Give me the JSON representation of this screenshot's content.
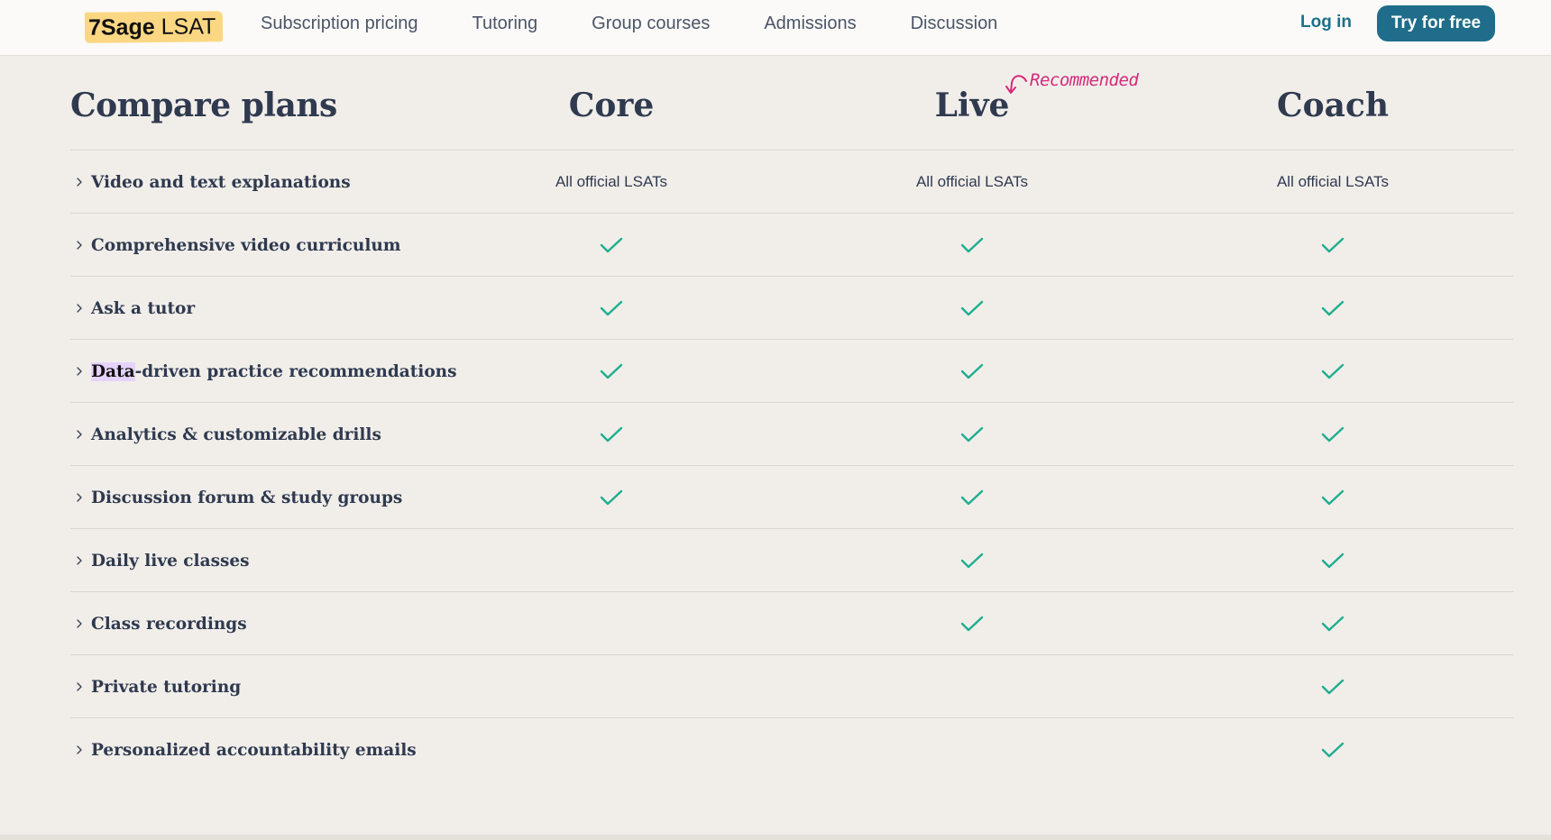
{
  "nav": {
    "logo_bold": "7Sage",
    "logo_light": "LSAT",
    "links": [
      "Subscription pricing",
      "Tutoring",
      "Group courses",
      "Admissions",
      "Discussion"
    ],
    "login": "Log in",
    "cta": "Try for free"
  },
  "compare": {
    "title": "Compare plans",
    "plans": [
      "Core",
      "Live",
      "Coach"
    ],
    "recommended_label": "Recommended",
    "recommended_plan": "Live",
    "check_color": "#1fae8f",
    "accent_color": "#d42a7a",
    "features": [
      {
        "label_pre": "",
        "label_hl": "",
        "label": "Video and text explanations",
        "core": "All official LSATs",
        "live": "All official LSATs",
        "coach": "All official LSATs"
      },
      {
        "label_pre": "",
        "label_hl": "",
        "label": "Comprehensive video curriculum",
        "core": true,
        "live": true,
        "coach": true
      },
      {
        "label_pre": "",
        "label_hl": "",
        "label": "Ask a tutor",
        "core": true,
        "live": true,
        "coach": true
      },
      {
        "label_pre": "",
        "label_hl": "Data",
        "label": "-driven practice recommendations",
        "core": true,
        "live": true,
        "coach": true
      },
      {
        "label_pre": "",
        "label_hl": "",
        "label": "Analytics & customizable drills",
        "core": true,
        "live": true,
        "coach": true
      },
      {
        "label_pre": "",
        "label_hl": "",
        "label": "Discussion forum & study groups",
        "core": true,
        "live": true,
        "coach": true
      },
      {
        "label_pre": "",
        "label_hl": "",
        "label": "Daily live classes",
        "core": false,
        "live": true,
        "coach": true
      },
      {
        "label_pre": "",
        "label_hl": "",
        "label": "Class recordings",
        "core": false,
        "live": true,
        "coach": true
      },
      {
        "label_pre": "",
        "label_hl": "",
        "label": "Private tutoring",
        "core": false,
        "live": false,
        "coach": true
      },
      {
        "label_pre": "",
        "label_hl": "",
        "label": "Personalized accountability emails",
        "core": false,
        "live": false,
        "coach": true
      }
    ]
  }
}
